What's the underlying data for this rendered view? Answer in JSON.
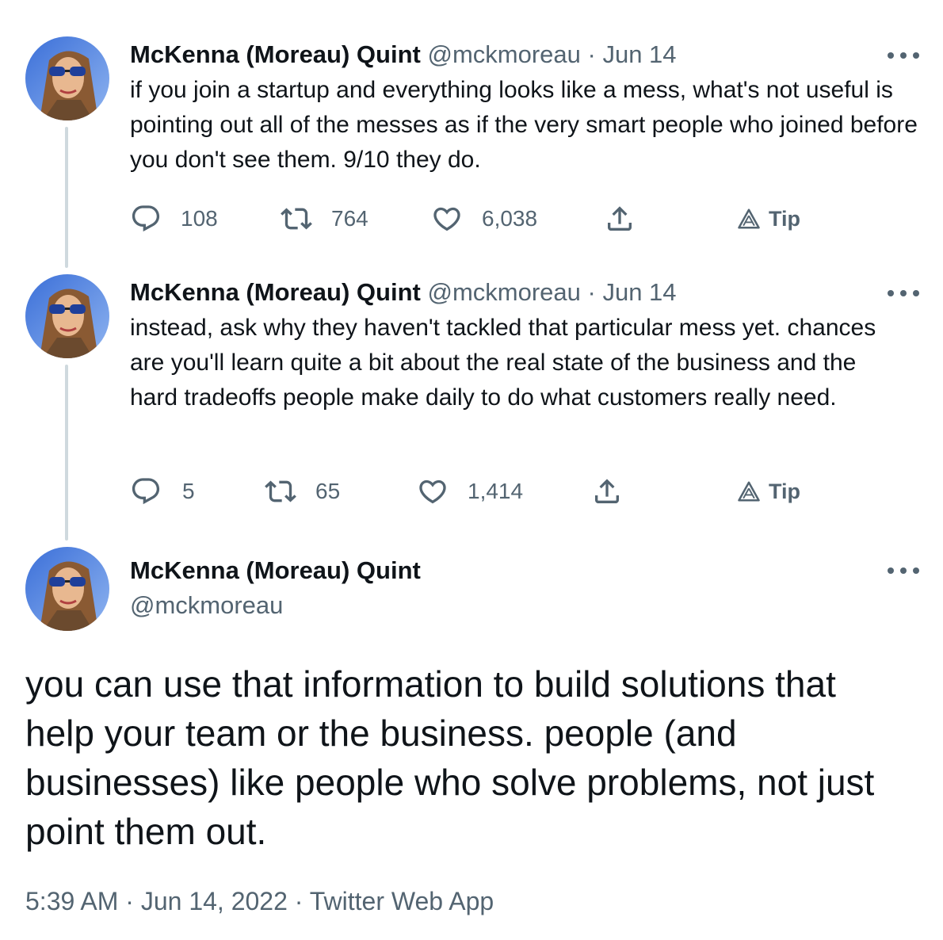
{
  "tweets": [
    {
      "name": "McKenna (Moreau) Quint",
      "handle": "@mckmoreau",
      "separator": "·",
      "date": "Jun 14",
      "text": "if you join a startup and everything looks like a mess, what's not useful is pointing out all of the messes as if the very smart people who joined before you don't see them. 9/10 they do.",
      "replies": "108",
      "retweets": "764",
      "likes": "6,038",
      "tip_label": "Tip"
    },
    {
      "name": "McKenna (Moreau) Quint",
      "handle": "@mckmoreau",
      "separator": "·",
      "date": "Jun 14",
      "text": "instead, ask why they haven't tackled that particular mess yet. chances are you'll learn quite a bit about the real state of the business and the hard tradeoffs people make daily to do what customers really need.",
      "replies": "5",
      "retweets": "65",
      "likes": "1,414",
      "tip_label": "Tip"
    }
  ],
  "main_tweet": {
    "name": "McKenna (Moreau) Quint",
    "handle": "@mckmoreau",
    "text": "you can use that information to build solutions that help your team or the business. people (and businesses) like people who solve problems, not just point them out.",
    "timestamp": "5:39 AM · Jun 14, 2022 · Twitter Web App"
  },
  "colors": {
    "text": "#0f1419",
    "muted": "#536471",
    "thread_line": "#cfd9de"
  },
  "icons": {
    "reply": "reply-icon",
    "retweet": "retweet-icon",
    "like": "heart-icon",
    "share": "share-icon",
    "tip": "tip-icon",
    "more": "more-icon"
  }
}
